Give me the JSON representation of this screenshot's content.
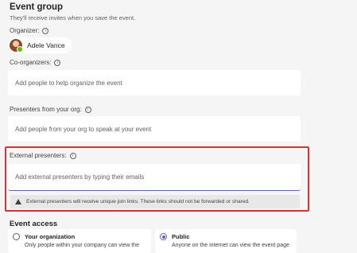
{
  "event_group": {
    "title": "Event group",
    "subtitle": "They'll receive invites when you save the event."
  },
  "organizer": {
    "label": "Organizer:",
    "name": "Adele Vance"
  },
  "co_organizers": {
    "label": "Co-organizers:",
    "placeholder": "Add people to help organize the event"
  },
  "presenters_org": {
    "label": "Presenters from your org:",
    "placeholder": "Add people from your org to speak at your event"
  },
  "external_presenters": {
    "label": "External presenters:",
    "placeholder": "Add external presenters by typing their emails",
    "warning": "External presenters will receive unique join links. These links should not be forwarded or shared."
  },
  "event_access": {
    "title": "Event access",
    "options": [
      {
        "title": "Your organization",
        "description": "Only people within your company can view the",
        "selected": false
      },
      {
        "title": "Public",
        "description": "Anyone on the internet can view the event page",
        "selected": true
      }
    ]
  },
  "colors": {
    "accent": "#6264a7",
    "highlight": "#d13438",
    "presence": "#6bb700"
  }
}
